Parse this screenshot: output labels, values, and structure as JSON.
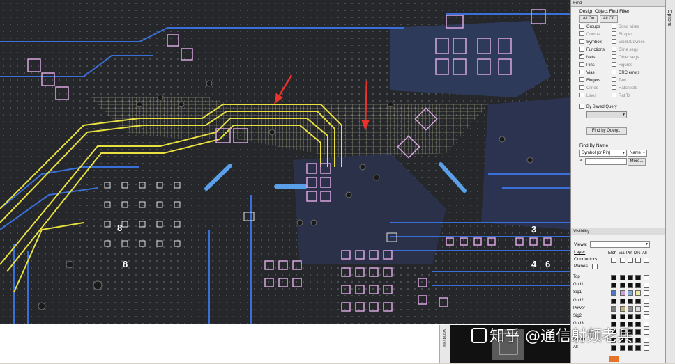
{
  "find_panel": {
    "title": "Find",
    "filter_title": "Design Object Find Filter",
    "all_on": "All On",
    "all_off": "All Off",
    "left_items": [
      {
        "label": "Groups",
        "checked": false,
        "enabled": true
      },
      {
        "label": "Comps",
        "checked": false,
        "enabled": false
      },
      {
        "label": "Symbols",
        "checked": false,
        "enabled": true
      },
      {
        "label": "Functions",
        "checked": false,
        "enabled": true
      },
      {
        "label": "Nets",
        "checked": true,
        "enabled": true
      },
      {
        "label": "Pins",
        "checked": false,
        "enabled": true
      },
      {
        "label": "Vias",
        "checked": false,
        "enabled": true
      },
      {
        "label": "Fingers",
        "checked": false,
        "enabled": true
      },
      {
        "label": "Clines",
        "checked": false,
        "enabled": false
      },
      {
        "label": "Lines",
        "checked": false,
        "enabled": false
      }
    ],
    "right_items": [
      {
        "label": "Bond wires",
        "checked": false,
        "enabled": false
      },
      {
        "label": "Shapes",
        "checked": false,
        "enabled": false
      },
      {
        "label": "Voids/Cavities",
        "checked": false,
        "enabled": false
      },
      {
        "label": "Cline segs",
        "checked": false,
        "enabled": false
      },
      {
        "label": "Other segs",
        "checked": false,
        "enabled": false
      },
      {
        "label": "Figures",
        "checked": false,
        "enabled": false
      },
      {
        "label": "DRC errors",
        "checked": false,
        "enabled": true
      },
      {
        "label": "Text",
        "checked": false,
        "enabled": false
      },
      {
        "label": "Ratsnests",
        "checked": false,
        "enabled": false
      },
      {
        "label": "Rat Ts",
        "checked": false,
        "enabled": false
      }
    ],
    "by_saved_query": "By Saved Query",
    "find_by_query": "Find by Query...",
    "find_by_name": "Find By Name",
    "symbol_select": "Symbol (or Pin)",
    "name_select": "Name",
    "name_prefix": ">",
    "more_button": "More..."
  },
  "visibility_panel": {
    "title": "Visibility",
    "views_label": "Views:",
    "layer_label": "Layer",
    "columns": [
      "Etch",
      "Via",
      "Pin",
      "Drc",
      "All"
    ],
    "conductors_label": "Conductors",
    "planes_label": "Planes",
    "layers": [
      {
        "name": "Top",
        "colors": [
          "#111111",
          "#111111",
          "#111111",
          "#111111"
        ]
      },
      {
        "name": "Gnd1",
        "colors": [
          "#111111",
          "#111111",
          "#111111",
          "#111111"
        ]
      },
      {
        "name": "Sig1",
        "colors": [
          "#4a77c9",
          "#c9a0d8",
          "#7fa9e0",
          "#e8e8a0"
        ]
      },
      {
        "name": "Gnd2",
        "colors": [
          "#111111",
          "#111111",
          "#111111",
          "#111111"
        ]
      },
      {
        "name": "Power",
        "colors": [
          "#7a7a7a",
          "#c4b07a",
          "#8a8a8a",
          "#dcdcdc"
        ]
      },
      {
        "name": "Sig2",
        "colors": [
          "#111111",
          "#111111",
          "#111111",
          "#111111"
        ]
      },
      {
        "name": "Gnd3",
        "colors": [
          "#111111",
          "#111111",
          "#111111",
          "#111111"
        ]
      },
      {
        "name": "",
        "colors": [
          "#111111",
          "#111111",
          "#111111",
          "#111111"
        ]
      },
      {
        "name": "Bottom",
        "colors": [
          "#111111",
          "#111111",
          "#111111",
          "#111111"
        ]
      },
      {
        "name": "All",
        "colors": [
          "#111111",
          "#111111",
          "#111111",
          "#111111"
        ]
      }
    ]
  },
  "options_tab": "Options",
  "command_strip": "WorldView",
  "watermark": "知乎 @通信射频老兵",
  "board_labels": [
    "8",
    "8",
    "3",
    "4",
    "6"
  ],
  "colors": {
    "board_bg": "#25272a",
    "trace_blue": "#3a6fd8",
    "trace_yellow": "#e8e040",
    "pad_pink": "#d9a6e0",
    "highlight_arrow": "#e8322a",
    "highlight_fill": "#d8d8a8"
  }
}
